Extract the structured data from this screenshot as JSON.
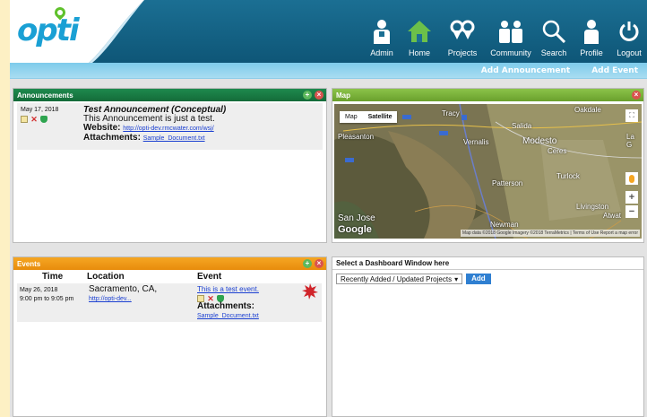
{
  "brand": {
    "logo_text": "opti"
  },
  "nav": {
    "admin": "Admin",
    "home": "Home",
    "projects": "Projects",
    "community": "Community",
    "search": "Search",
    "profile": "Profile",
    "logout": "Logout"
  },
  "actions": {
    "add_announcement": "Add Announcement",
    "add_event": "Add Event"
  },
  "announcements": {
    "title": "Announcements",
    "item": {
      "date": "May 17, 2018",
      "title": "Test Announcement (Conceptual)",
      "body": "This Announcement is just a test.",
      "website_label": "Website:",
      "website_url": "http://opti-dev.rmcwater.com/wsj/",
      "attachments_label": "Attachments:",
      "attachment": "Sample_Document.txt"
    }
  },
  "map": {
    "title": "Map",
    "btn_map": "Map",
    "btn_satellite": "Satellite",
    "places": {
      "tracy": "Tracy",
      "oakdale": "Oakdale",
      "pleasanton": "Pleasanton",
      "salida": "Salida",
      "vernalis": "Vernalis",
      "modesto": "Modesto",
      "ceres": "Ceres",
      "patterson": "Patterson",
      "turlock": "Turlock",
      "livingston": "Livingston",
      "atwater": "Atwat",
      "san_jose": "San Jose",
      "newman": "Newman",
      "lag": "La G"
    },
    "google": "Google",
    "footer": "Map data ©2018 Google Imagery ©2018 TerraMetrics | Terms of Use   Report a map error"
  },
  "events": {
    "title": "Events",
    "col_time": "Time",
    "col_location": "Location",
    "col_event": "Event",
    "item": {
      "date": "May 26, 2018",
      "time": "9:00 pm to 9:05 pm",
      "location": "Sacramento, CA,",
      "location_link": "http://opti-dev...",
      "event_link": "This is a test event.",
      "attachments_label": "Attachments:",
      "attachment": "Sample_Document.txt"
    }
  },
  "dashboard": {
    "title": "Select a Dashboard Window here",
    "selected": "Recently Added / Updated Projects",
    "add_label": "Add"
  },
  "colors": {
    "header": "#1b6f93",
    "announcements_head": "#1e8a4e",
    "map_head": "#8bc34a",
    "events_head": "#f5a623",
    "link": "#1a3fd1"
  }
}
